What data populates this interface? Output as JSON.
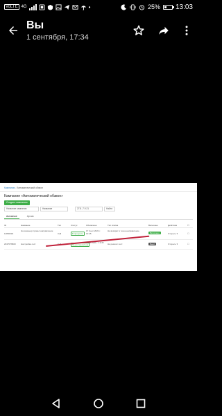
{
  "status_bar": {
    "time": "13:03",
    "battery_percent": "25%",
    "net_label": "VoLTE",
    "signal_label": "4G",
    "battery_level": 0.25
  },
  "header": {
    "title": "Вы",
    "subtitle": "1 сентября, 17:34"
  },
  "photo": {
    "breadcrumb": [
      "Кампании",
      "Автоматический обзвон"
    ],
    "page_title": "Кампания «Автоматический обзвон»",
    "create_button": "Создать кампанию",
    "filters": {
      "campaign_label": "Название кампании",
      "title_field": "Название",
      "date_field": "27.8.-7.9.21",
      "search": "Найти"
    },
    "tabs": [
      "Активные",
      "Архив"
    ],
    "columns": [
      "ID",
      "Название",
      "Тип",
      "Статус",
      "Обновлено",
      "Тип списка",
      "Включено",
      "Действия"
    ],
    "rows": [
      {
        "id": "11890030",
        "name": "На инженер провел направление",
        "type": "Call",
        "status": "В процессе",
        "updated": "17 Сент 2021 г. 13:45",
        "list_type": "На возврат в техно-направление",
        "enabled": "Включено",
        "action": "Открыть"
      },
      {
        "id": "2047076800",
        "name": "Настройка-тест",
        "type": "Call",
        "status": "Приостановлена",
        "updated": "9 Авг 2021 г. 13:45",
        "list_type": "На ремонт-тест",
        "enabled": "Выкл",
        "action": "Открыть"
      }
    ]
  },
  "colors": {
    "accent": "#3fae49",
    "annotation": "#c0223b"
  }
}
